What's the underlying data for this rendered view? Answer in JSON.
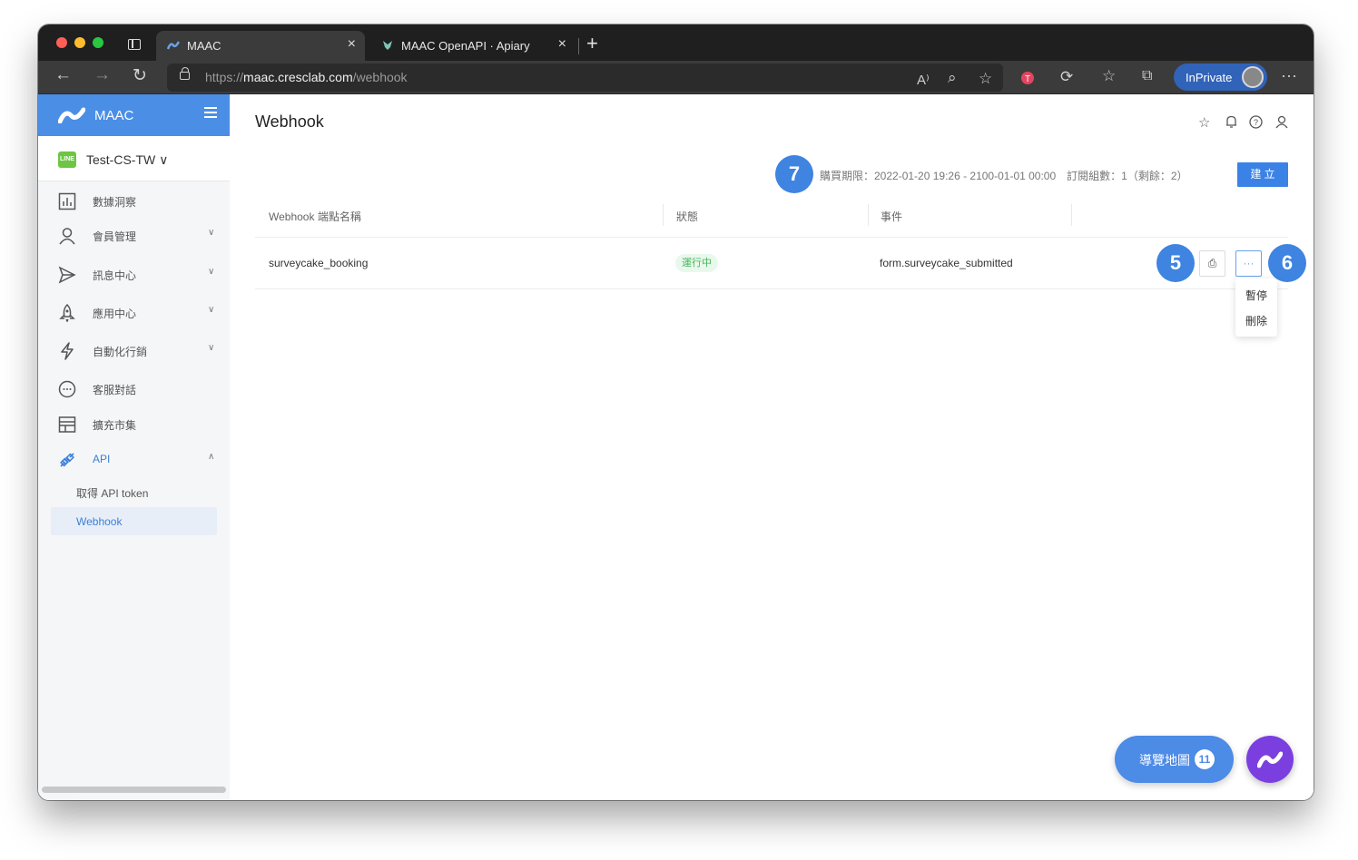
{
  "browser": {
    "tabs": [
      {
        "title": "MAAC",
        "close": "×"
      },
      {
        "title": "MAAC OpenAPI · Apiary",
        "close": "×"
      }
    ],
    "new_tab": "+",
    "url_scheme": "https://",
    "url_host": "maac.cresclab.com",
    "url_path": "/webhook",
    "inprivate_label": "InPrivate",
    "more": "···",
    "nav": {
      "back": "←",
      "forward": "→",
      "reload": "↻"
    },
    "toolbar_icons": {
      "read_aloud": "A⁾",
      "zoom": "⌕",
      "favorite_add": "☆",
      "extensions": "⟳",
      "favorites": "☆",
      "collections": "⧉"
    }
  },
  "sidebar": {
    "brand": "MAAC",
    "account": {
      "logo_text": "LINE",
      "name": "Test-CS-TW ∨"
    },
    "items": [
      {
        "label": "數據洞察",
        "icon": "chart-icon",
        "chevron": ""
      },
      {
        "label": "會員管理",
        "icon": "user-icon",
        "chevron": "∨"
      },
      {
        "label": "訊息中心",
        "icon": "send-icon",
        "chevron": "∨"
      },
      {
        "label": "應用中心",
        "icon": "rocket-icon",
        "chevron": "∨"
      },
      {
        "label": "自動化行銷",
        "icon": "lightning-icon",
        "chevron": "∨"
      },
      {
        "label": "客服對話",
        "icon": "chat-icon",
        "chevron": ""
      },
      {
        "label": "擴充市集",
        "icon": "store-icon",
        "chevron": ""
      },
      {
        "label": "API",
        "icon": "plug-icon",
        "chevron": "∧"
      }
    ],
    "sub_items": [
      {
        "label": "取得 API token",
        "active": false
      },
      {
        "label": "Webhook",
        "active": true
      }
    ]
  },
  "main": {
    "title": "Webhook",
    "header_icons": [
      "star-icon",
      "bell-icon",
      "help-icon",
      "user-icon"
    ],
    "purchase_info": "購買期限：2022-01-20 19:26 - 2100-01-01 00:00　訂閱組數：1（剩餘：2）",
    "create_label": "建 立",
    "table": {
      "columns": [
        "Webhook 端點名稱",
        "狀態",
        "事件"
      ],
      "rows": [
        {
          "name": "surveycake_booking",
          "status": "運行中",
          "event": "form.surveycake_submitted"
        }
      ]
    },
    "row_actions": {
      "detail_icon": "⎙",
      "more_icon": "···"
    },
    "dropdown": [
      "暫停",
      "刪除"
    ],
    "badges": {
      "b7": "7",
      "b5": "5",
      "b6": "6"
    },
    "tour": {
      "label": "導覽地圖",
      "count": "11"
    }
  },
  "colors": {
    "brand": "#4a8ee6",
    "accent": "#3b82e6",
    "status_green": "#46b35d",
    "badge": "#3e84e0",
    "fab": "#7b3fe0"
  }
}
